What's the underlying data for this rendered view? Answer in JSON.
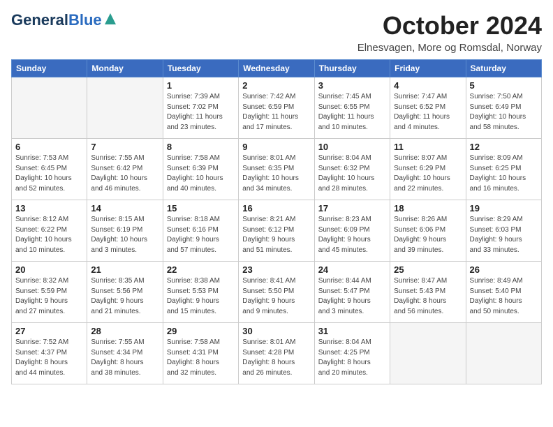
{
  "header": {
    "logo_line1": "General",
    "logo_line2": "Blue",
    "month": "October 2024",
    "location": "Elnesvagen, More og Romsdal, Norway"
  },
  "days_of_week": [
    "Sunday",
    "Monday",
    "Tuesday",
    "Wednesday",
    "Thursday",
    "Friday",
    "Saturday"
  ],
  "weeks": [
    [
      {
        "day": "",
        "info": ""
      },
      {
        "day": "",
        "info": ""
      },
      {
        "day": "1",
        "info": "Sunrise: 7:39 AM\nSunset: 7:02 PM\nDaylight: 11 hours\nand 23 minutes."
      },
      {
        "day": "2",
        "info": "Sunrise: 7:42 AM\nSunset: 6:59 PM\nDaylight: 11 hours\nand 17 minutes."
      },
      {
        "day": "3",
        "info": "Sunrise: 7:45 AM\nSunset: 6:55 PM\nDaylight: 11 hours\nand 10 minutes."
      },
      {
        "day": "4",
        "info": "Sunrise: 7:47 AM\nSunset: 6:52 PM\nDaylight: 11 hours\nand 4 minutes."
      },
      {
        "day": "5",
        "info": "Sunrise: 7:50 AM\nSunset: 6:49 PM\nDaylight: 10 hours\nand 58 minutes."
      }
    ],
    [
      {
        "day": "6",
        "info": "Sunrise: 7:53 AM\nSunset: 6:45 PM\nDaylight: 10 hours\nand 52 minutes."
      },
      {
        "day": "7",
        "info": "Sunrise: 7:55 AM\nSunset: 6:42 PM\nDaylight: 10 hours\nand 46 minutes."
      },
      {
        "day": "8",
        "info": "Sunrise: 7:58 AM\nSunset: 6:39 PM\nDaylight: 10 hours\nand 40 minutes."
      },
      {
        "day": "9",
        "info": "Sunrise: 8:01 AM\nSunset: 6:35 PM\nDaylight: 10 hours\nand 34 minutes."
      },
      {
        "day": "10",
        "info": "Sunrise: 8:04 AM\nSunset: 6:32 PM\nDaylight: 10 hours\nand 28 minutes."
      },
      {
        "day": "11",
        "info": "Sunrise: 8:07 AM\nSunset: 6:29 PM\nDaylight: 10 hours\nand 22 minutes."
      },
      {
        "day": "12",
        "info": "Sunrise: 8:09 AM\nSunset: 6:25 PM\nDaylight: 10 hours\nand 16 minutes."
      }
    ],
    [
      {
        "day": "13",
        "info": "Sunrise: 8:12 AM\nSunset: 6:22 PM\nDaylight: 10 hours\nand 10 minutes."
      },
      {
        "day": "14",
        "info": "Sunrise: 8:15 AM\nSunset: 6:19 PM\nDaylight: 10 hours\nand 3 minutes."
      },
      {
        "day": "15",
        "info": "Sunrise: 8:18 AM\nSunset: 6:16 PM\nDaylight: 9 hours\nand 57 minutes."
      },
      {
        "day": "16",
        "info": "Sunrise: 8:21 AM\nSunset: 6:12 PM\nDaylight: 9 hours\nand 51 minutes."
      },
      {
        "day": "17",
        "info": "Sunrise: 8:23 AM\nSunset: 6:09 PM\nDaylight: 9 hours\nand 45 minutes."
      },
      {
        "day": "18",
        "info": "Sunrise: 8:26 AM\nSunset: 6:06 PM\nDaylight: 9 hours\nand 39 minutes."
      },
      {
        "day": "19",
        "info": "Sunrise: 8:29 AM\nSunset: 6:03 PM\nDaylight: 9 hours\nand 33 minutes."
      }
    ],
    [
      {
        "day": "20",
        "info": "Sunrise: 8:32 AM\nSunset: 5:59 PM\nDaylight: 9 hours\nand 27 minutes."
      },
      {
        "day": "21",
        "info": "Sunrise: 8:35 AM\nSunset: 5:56 PM\nDaylight: 9 hours\nand 21 minutes."
      },
      {
        "day": "22",
        "info": "Sunrise: 8:38 AM\nSunset: 5:53 PM\nDaylight: 9 hours\nand 15 minutes."
      },
      {
        "day": "23",
        "info": "Sunrise: 8:41 AM\nSunset: 5:50 PM\nDaylight: 9 hours\nand 9 minutes."
      },
      {
        "day": "24",
        "info": "Sunrise: 8:44 AM\nSunset: 5:47 PM\nDaylight: 9 hours\nand 3 minutes."
      },
      {
        "day": "25",
        "info": "Sunrise: 8:47 AM\nSunset: 5:43 PM\nDaylight: 8 hours\nand 56 minutes."
      },
      {
        "day": "26",
        "info": "Sunrise: 8:49 AM\nSunset: 5:40 PM\nDaylight: 8 hours\nand 50 minutes."
      }
    ],
    [
      {
        "day": "27",
        "info": "Sunrise: 7:52 AM\nSunset: 4:37 PM\nDaylight: 8 hours\nand 44 minutes."
      },
      {
        "day": "28",
        "info": "Sunrise: 7:55 AM\nSunset: 4:34 PM\nDaylight: 8 hours\nand 38 minutes."
      },
      {
        "day": "29",
        "info": "Sunrise: 7:58 AM\nSunset: 4:31 PM\nDaylight: 8 hours\nand 32 minutes."
      },
      {
        "day": "30",
        "info": "Sunrise: 8:01 AM\nSunset: 4:28 PM\nDaylight: 8 hours\nand 26 minutes."
      },
      {
        "day": "31",
        "info": "Sunrise: 8:04 AM\nSunset: 4:25 PM\nDaylight: 8 hours\nand 20 minutes."
      },
      {
        "day": "",
        "info": ""
      },
      {
        "day": "",
        "info": ""
      }
    ]
  ]
}
